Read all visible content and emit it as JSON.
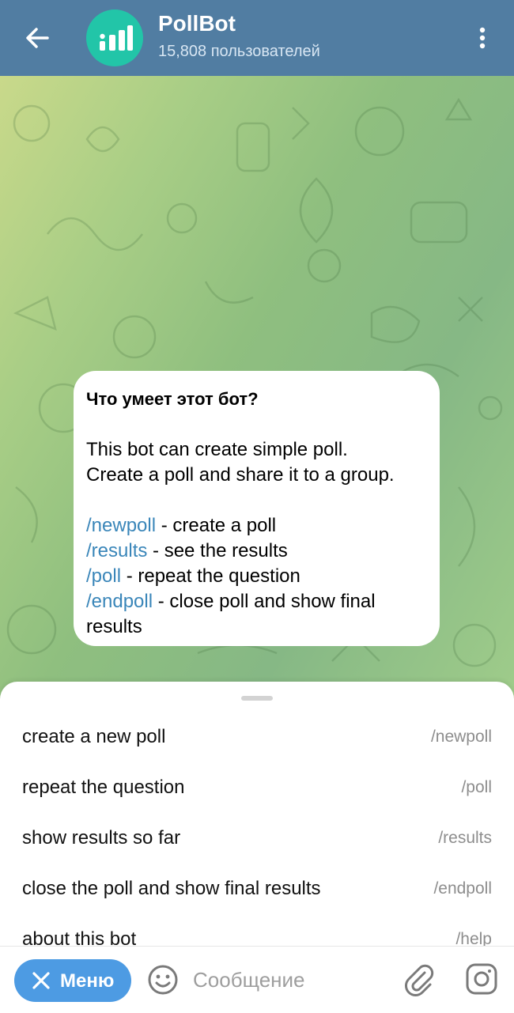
{
  "header": {
    "title": "PollBot",
    "subtitle": "15,808 пользователей",
    "bg_color": "#517da2",
    "avatar_color": "#22c5a8",
    "back_icon": "arrow-left-icon",
    "more_icon": "more-vertical-icon"
  },
  "message": {
    "heading": "Что умеет этот бот?",
    "line1": "This bot can create simple poll.",
    "line2": "Create a poll and share it to a group.",
    "commands": [
      {
        "cmd": "/newpoll",
        "text": " - create a poll"
      },
      {
        "cmd": "/results",
        "text": " - see the results"
      },
      {
        "cmd": "/poll",
        "text": " - repeat the question"
      },
      {
        "cmd": "/endpoll",
        "text": " - close poll and show final results"
      }
    ]
  },
  "command_list": [
    {
      "description": "create a new poll",
      "command": "/newpoll"
    },
    {
      "description": "repeat the question",
      "command": "/poll"
    },
    {
      "description": "show results so far",
      "command": "/results"
    },
    {
      "description": "close the poll and show final results",
      "command": "/endpoll"
    },
    {
      "description": "about this bot",
      "command": "/help"
    }
  ],
  "input_bar": {
    "menu_label": "Меню",
    "placeholder": "Сообщение",
    "menu_color": "#4d9be3",
    "emoji_icon": "smile-icon",
    "attach_icon": "paperclip-icon",
    "camera_icon": "instagram-camera-icon"
  }
}
